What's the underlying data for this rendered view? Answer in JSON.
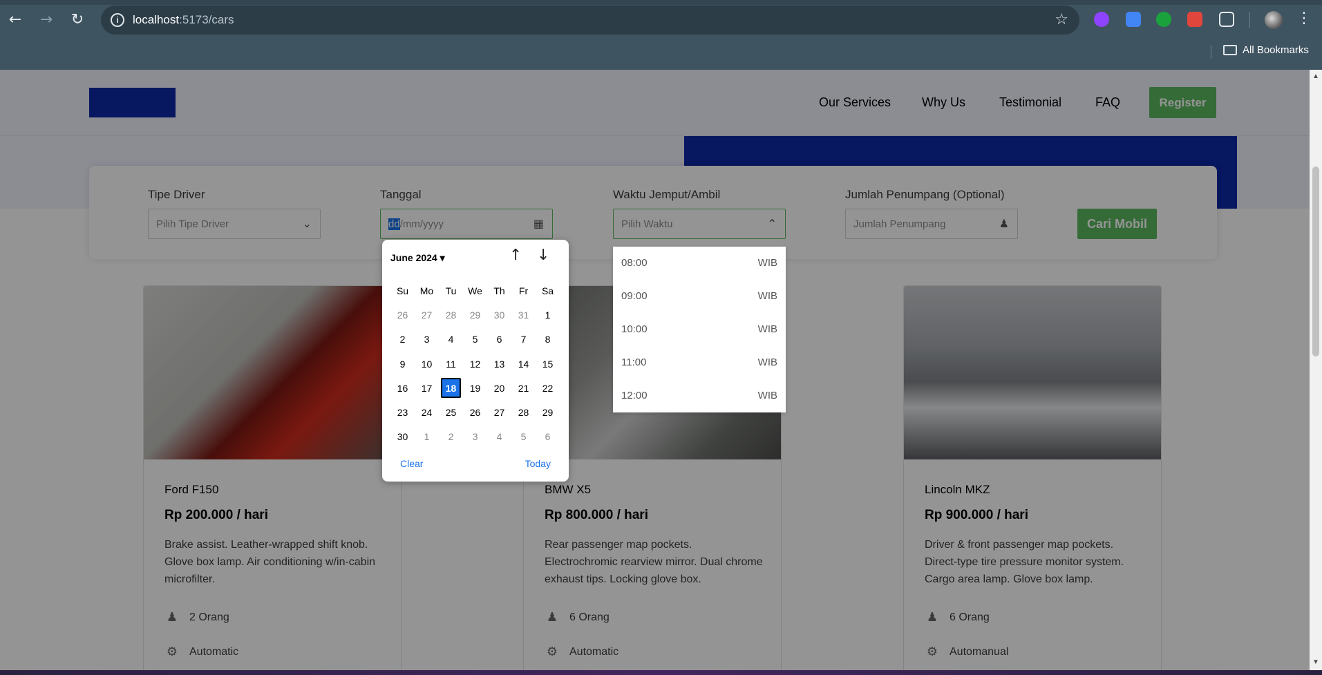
{
  "browser": {
    "url_host": "localhost",
    "url_path": ":5173/cars",
    "bookmarks_label": "All Bookmarks",
    "extension_colors": [
      "#8e44ff",
      "#4285f4",
      "#1aa33d",
      "#e0463c",
      "#ffffff"
    ]
  },
  "nav": {
    "items": [
      "Our Services",
      "Why Us",
      "Testimonial",
      "FAQ"
    ],
    "register_label": "Register",
    "brand_color": "#0d28a6",
    "accent_color": "#5cb85f"
  },
  "search": {
    "driver_label": "Tipe Driver",
    "driver_placeholder": "Pilih Tipe Driver",
    "date_label": "Tanggal",
    "date_placeholder_selected": "dd",
    "date_placeholder_rest": "/mm/yyyy",
    "time_label": "Waktu Jemput/Ambil",
    "time_placeholder": "Pilih Waktu",
    "passenger_label": "Jumlah Penumpang (Optional)",
    "passenger_placeholder": "Jumlah Penumpang",
    "submit_label": "Cari Mobil"
  },
  "datepicker": {
    "month_label": "June 2024",
    "weekdays": [
      "Su",
      "Mo",
      "Tu",
      "We",
      "Th",
      "Fr",
      "Sa"
    ],
    "days": [
      [
        "26",
        "27",
        "28",
        "29",
        "30",
        "31",
        "1"
      ],
      [
        "2",
        "3",
        "4",
        "5",
        "6",
        "7",
        "8"
      ],
      [
        "9",
        "10",
        "11",
        "12",
        "13",
        "14",
        "15"
      ],
      [
        "16",
        "17",
        "18",
        "19",
        "20",
        "21",
        "22"
      ],
      [
        "23",
        "24",
        "25",
        "26",
        "27",
        "28",
        "29"
      ],
      [
        "30",
        "1",
        "2",
        "3",
        "4",
        "5",
        "6"
      ]
    ],
    "selected_day": "18",
    "clear_label": "Clear",
    "today_label": "Today"
  },
  "time_options": [
    {
      "time": "08:00",
      "zone": "WIB"
    },
    {
      "time": "09:00",
      "zone": "WIB"
    },
    {
      "time": "10:00",
      "zone": "WIB"
    },
    {
      "time": "11:00",
      "zone": "WIB"
    },
    {
      "time": "12:00",
      "zone": "WIB"
    }
  ],
  "cars": [
    {
      "name": "Ford F150",
      "price": "Rp 200.000 / hari",
      "description": "Brake assist. Leather-wrapped shift knob. Glove box lamp. Air conditioning w/in-cabin microfilter.",
      "capacity": "2 Orang",
      "transmission": "Automatic"
    },
    {
      "name": "BMW X5",
      "price": "Rp 800.000 / hari",
      "description": "Rear passenger map pockets. Electrochromic rearview mirror. Dual chrome exhaust tips. Locking glove box.",
      "capacity": "6 Orang",
      "transmission": "Automatic"
    },
    {
      "name": "Lincoln MKZ",
      "price": "Rp 900.000 / hari",
      "description": "Driver & front passenger map pockets. Direct-type tire pressure monitor system. Cargo area lamp. Glove box lamp.",
      "capacity": "6 Orang",
      "transmission": "Automanual"
    }
  ]
}
